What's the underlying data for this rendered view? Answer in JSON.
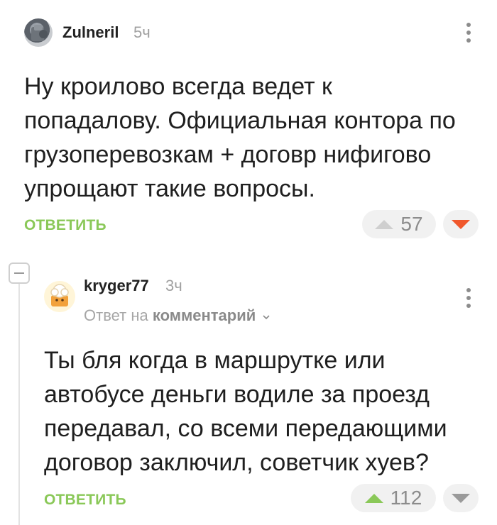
{
  "comments": [
    {
      "author": "Zulneril",
      "time": "5ч",
      "text": "Ну кроилово всегда ведет к попадалову. Официальная контора по грузоперевозкам + договр нифигово упрощают такие вопросы.",
      "reply_label": "ОТВЕТИТЬ",
      "rating": "57",
      "colors": {
        "upvote": "#cfcfcf",
        "downvote": "#f0582c"
      }
    },
    {
      "author": "kryger77",
      "time": "3ч",
      "reply_to_prefix": "Ответ на",
      "reply_to_target": "комментарий",
      "text": "Ты бля когда в маршрутке или автобусе деньги водиле за проезд передавал, со всеми передающими договор заключил, советчик хуев?",
      "reply_label": "ОТВЕТИТЬ",
      "rating": "112",
      "colors": {
        "upvote": "#8ac858",
        "downvote": "#9a9a9a"
      }
    }
  ],
  "icons": {
    "more": "kebab-icon",
    "collapse": "minus-icon",
    "reply_to_expand": "chevron-down-icon"
  }
}
